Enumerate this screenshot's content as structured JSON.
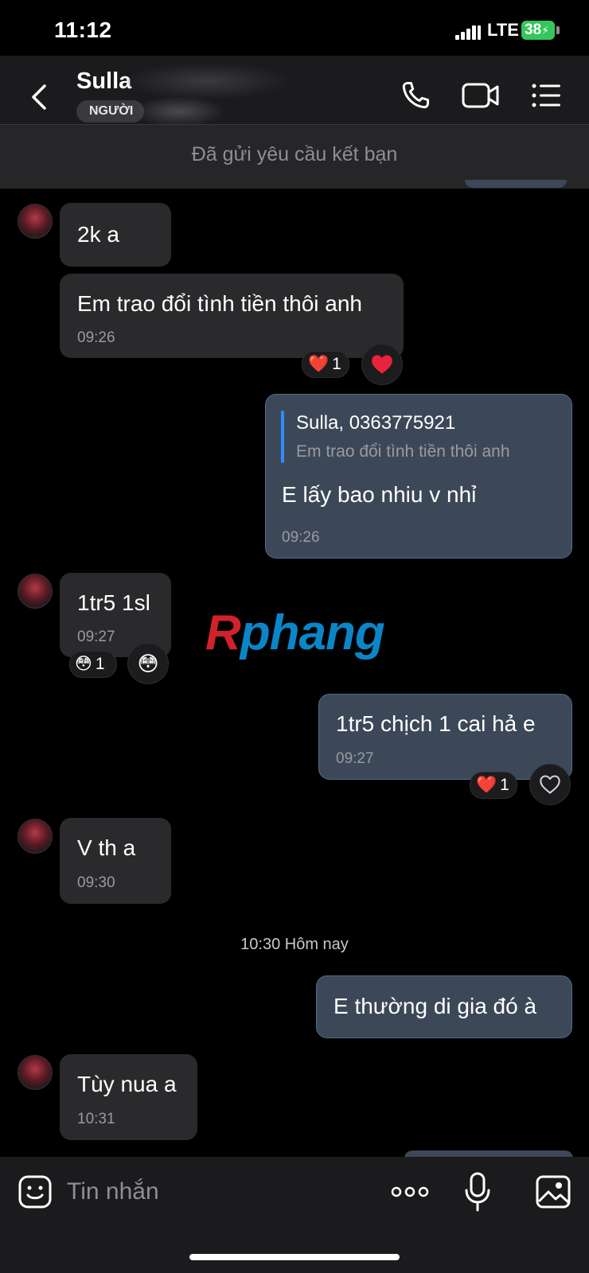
{
  "status_bar": {
    "time": "11:12",
    "network": "LTE",
    "battery": "38"
  },
  "header": {
    "contact_name": "Sulla",
    "status_badge": "NGƯỜI"
  },
  "request_banner": {
    "text": "Đã gửi yêu cầu kết bạn"
  },
  "messages": [
    {
      "text": "2k a"
    },
    {
      "text": "Em trao đổi tình tiền thôi anh",
      "time": "09:26",
      "reaction": "❤️",
      "reaction_count": "1"
    },
    {
      "reply_name": "Sulla, 0363775921",
      "reply_quote": "Em trao đổi tình tiền thôi anh",
      "text": "E lấy bao nhiu v nhỉ",
      "time": "09:26"
    },
    {
      "text": "1tr5 1sl",
      "time": "09:27",
      "reaction": "😳",
      "reaction_count": "1"
    },
    {
      "text": "1tr5 chịch 1 cai hả e",
      "time": "09:27",
      "reaction": "❤️",
      "reaction_count": "1"
    },
    {
      "text": "V th a",
      "time": "09:30"
    },
    {
      "text": "E thường di gia đó à"
    },
    {
      "text": "Tùy nua a",
      "time": "10:31"
    }
  ],
  "divider": {
    "time": "10:30 Hôm nay"
  },
  "watermark": {
    "part1": "R",
    "part2": "phang"
  },
  "composer": {
    "placeholder": "Tin nhắn"
  },
  "icons": {
    "back": "chevron-left-icon",
    "call": "phone-icon",
    "video": "video-camera-icon",
    "menu": "list-menu-icon",
    "sticker": "smiley-sticker-icon",
    "more": "more-dots-icon",
    "mic": "microphone-icon",
    "image": "image-gallery-icon",
    "react": "heart-outline-icon"
  },
  "colors": {
    "outgoing_bubble": "#3c4858",
    "incoming_bubble": "#2a2a2c",
    "battery": "#34c759",
    "reply_bar": "#2d8cff"
  }
}
